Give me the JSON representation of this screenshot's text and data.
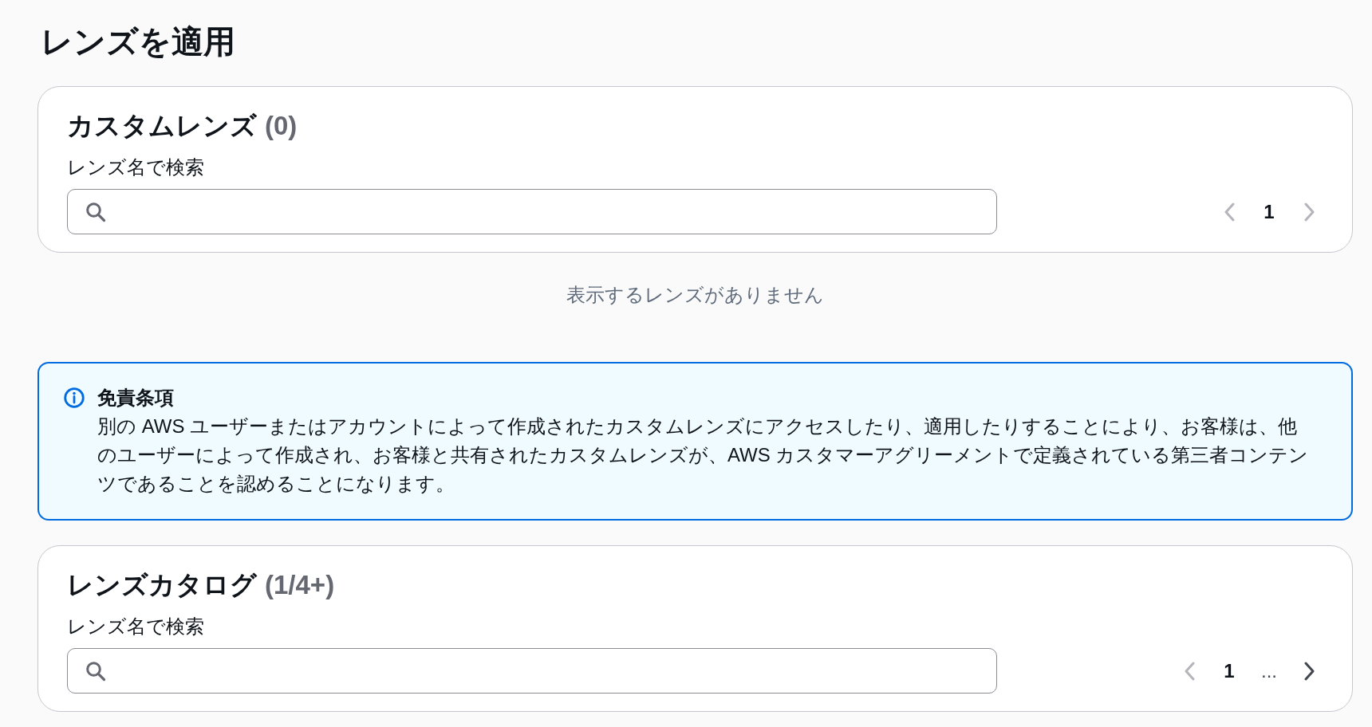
{
  "page_title": "レンズを適用",
  "custom_lenses": {
    "heading": "カスタムレンズ",
    "count": "(0)",
    "search": {
      "label": "レンズ名で検索"
    },
    "pagination": [
      {
        "kind": "previous",
        "disabled": true
      },
      {
        "kind": "page",
        "label": "1",
        "selected": true
      },
      {
        "kind": "next",
        "disabled": true
      }
    ],
    "empty_message": "表示するレンズがありません"
  },
  "disclaimer": {
    "title": "免責条項",
    "body": "別の AWS ユーザーまたはアカウントによって作成されたカスタムレンズにアクセスしたり、適用したりすることにより、お客様は、他のユーザーによって作成され、お客様と共有されたカスタムレンズが、AWS カスタマーアグリーメントで定義されている第三者コンテンツであることを認めることになります。"
  },
  "lens_catalog": {
    "heading": "レンズカタログ",
    "count": "(1/4+)",
    "search": {
      "label": "レンズ名で検索"
    },
    "pagination": [
      {
        "kind": "previous",
        "disabled": true
      },
      {
        "kind": "page",
        "label": "1",
        "selected": true
      },
      {
        "kind": "ellipsis",
        "label": "..."
      },
      {
        "kind": "next",
        "disabled": false
      }
    ]
  }
}
